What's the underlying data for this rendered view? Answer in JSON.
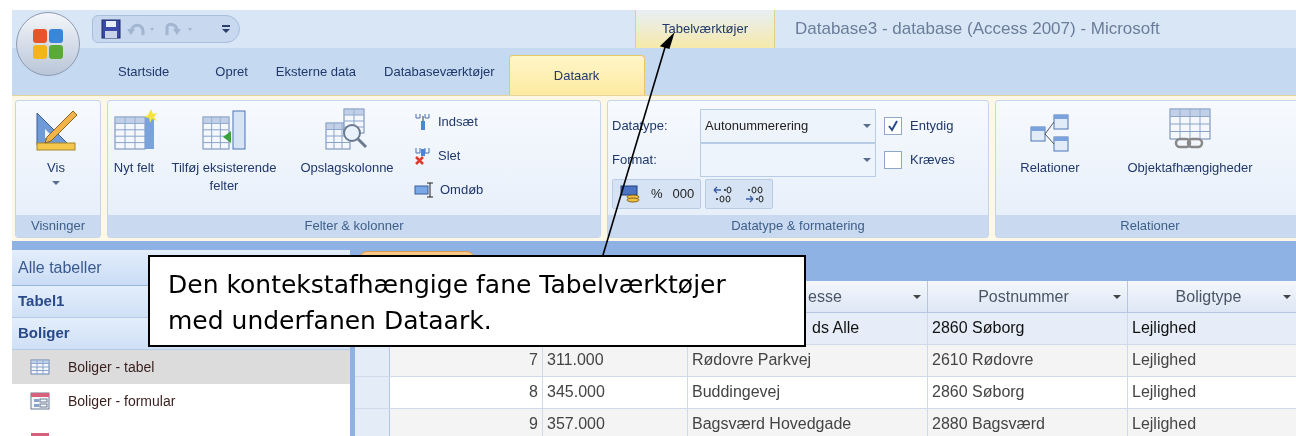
{
  "window": {
    "title": "Database3 - database (Access 2007) - Microsoft"
  },
  "quick_access": [
    {
      "disabled": false
    },
    {
      "disabled": true
    },
    {
      "disabled": true
    },
    {
      "disabled": false
    }
  ],
  "contextual_tab_group": {
    "label": "Tabelværktøjer"
  },
  "tabs": [
    {
      "label": "Startside",
      "selected": false,
      "kind": "normal"
    },
    {
      "label": "Opret",
      "selected": false,
      "kind": "normal"
    },
    {
      "label": "Eksterne data",
      "selected": false,
      "kind": "normal"
    },
    {
      "label": "Databaseværktøjer",
      "selected": false,
      "kind": "normal"
    },
    {
      "label": "Dataark",
      "selected": true,
      "kind": "contextual"
    }
  ],
  "ribbon": {
    "groups": [
      {
        "label": "Visninger",
        "items": [
          {
            "kind": "large",
            "label": "Vis",
            "dropdown": true
          }
        ]
      },
      {
        "label": "Felter & kolonner",
        "items": [
          {
            "kind": "large",
            "label": "Nyt felt",
            "dropdown": false
          },
          {
            "kind": "large",
            "label": "Tilføj eksisterende felter",
            "dropdown": false
          },
          {
            "kind": "large",
            "label": "Opslagskolonne",
            "dropdown": false
          },
          {
            "kind": "stack",
            "buttons": [
              {
                "label": "Indsæt"
              },
              {
                "label": "Slet"
              },
              {
                "label": "Omdøb"
              }
            ]
          }
        ]
      },
      {
        "label": "Datatype & formatering",
        "items": [
          {
            "kind": "formatting",
            "fields": [
              {
                "label": "Datatype:",
                "value": "Autonummerering"
              },
              {
                "label": "Format:"
              }
            ],
            "checkboxes": [
              {
                "label": "Entydig",
                "checked": true
              },
              {
                "label": "Kræves",
                "checked": false
              }
            ],
            "format_buttons": [
              {
                "kind": "currency"
              },
              {
                "kind": "text",
                "text": "%"
              },
              {
                "kind": "text",
                "text": "000"
              }
            ],
            "decimal_buttons": [
              {
                "kind": "increase"
              },
              {
                "kind": "decrease"
              }
            ]
          }
        ]
      },
      {
        "label": "Relationer",
        "items": [
          {
            "kind": "large",
            "label": "Relationer",
            "dropdown": false
          },
          {
            "kind": "large",
            "label": "Objektafhængigheder",
            "dropdown": false
          }
        ]
      }
    ]
  },
  "navigation_pane": {
    "header": "Alle tabeller",
    "groups": [
      {
        "label": "Tabel1"
      },
      {
        "label": "Boliger",
        "items": [
          {
            "kind": "table",
            "label": "Boliger - tabel",
            "selected": true
          },
          {
            "kind": "form",
            "label": "Boliger - formular",
            "selected": false
          },
          {
            "kind": "report",
            "selected": false
          }
        ]
      }
    ]
  },
  "datasheet": {
    "columns": [
      {
        "kind": "id"
      },
      {
        "kind": "price"
      },
      {
        "kind": "text",
        "label": "esse"
      },
      {
        "kind": "text",
        "label": "Postnummer"
      },
      {
        "kind": "text",
        "label": "Boligtype"
      }
    ],
    "rows": [
      {
        "selected": true,
        "cells": [
          null,
          null,
          "ds Alle",
          "2860 Søborg",
          "Lejlighed"
        ]
      },
      {
        "selected": false,
        "cells": [
          "7",
          "311.000",
          "Rødovre Parkvej",
          "2610 Rødovre",
          "Lejlighed"
        ]
      },
      {
        "selected": false,
        "cells": [
          "8",
          "345.000",
          "Buddingevej",
          "2860 Søborg",
          "Lejlighed"
        ]
      },
      {
        "selected": false,
        "cells": [
          "9",
          "357.000",
          "Bagsværd Hovedgade",
          "2880 Bagsværd",
          "Lejlighed"
        ]
      }
    ]
  },
  "callout": {
    "text": "Den kontekstafhængige fane Tabelværktøjer med underfanen Dataark."
  }
}
